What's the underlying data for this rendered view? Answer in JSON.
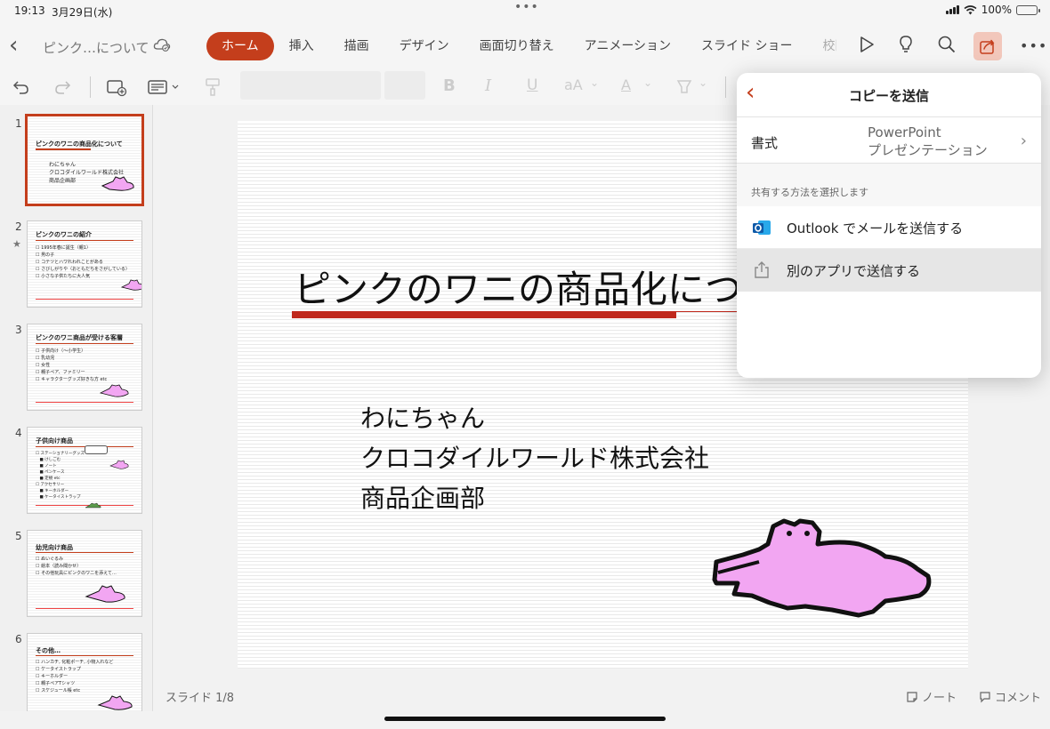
{
  "status_bar": {
    "time": "19:13",
    "date": "3月29日(水)",
    "battery": "100%"
  },
  "document": {
    "title": "ピンク…について"
  },
  "ribbon": {
    "tabs": [
      {
        "label": "ホーム",
        "active": true
      },
      {
        "label": "挿入"
      },
      {
        "label": "描画"
      },
      {
        "label": "デザイン"
      },
      {
        "label": "画面切り替え"
      },
      {
        "label": "アニメーション"
      },
      {
        "label": "スライド ショー"
      },
      {
        "label": "校閲"
      }
    ]
  },
  "icons": {
    "back": "chevron-left-icon",
    "cloud": "cloud-sync-icon",
    "play": "play-icon",
    "ideas": "lightbulb-icon",
    "search": "search-icon",
    "share": "share-icon",
    "more": "more-icon",
    "undo": "undo-icon",
    "redo": "redo-icon",
    "new_slide": "new-slide-icon",
    "layout": "layout-icon",
    "format_painter": "format-painter-icon",
    "bold": "bold-icon",
    "italic": "italic-icon",
    "underline": "underline-icon",
    "font_size": "font-size-icon",
    "font_color": "font-color-icon",
    "highlight": "highlight-icon"
  },
  "toolbar": {
    "bold": "B",
    "italic": "I",
    "underline": "U",
    "font_size": "aA",
    "font_color": "A"
  },
  "accent_color": "#c43e1c",
  "thumbnails": [
    {
      "num": "1",
      "title": "ピンクのワニの商品化について",
      "body": [
        "わにちゃん",
        "クロコダイルワールド株式会社",
        "商品企画部"
      ]
    },
    {
      "num": "2",
      "star": "★",
      "title": "ピンクのワニの紹介",
      "body": [
        "☐ 1995年春に誕生（親1）",
        "☐ 男の子",
        "☐ コテツとハワれわれことがある",
        "☐ さびしがりや（おともだちをさがしている）",
        "☐ 小さな子供たちに大人気"
      ]
    },
    {
      "num": "3",
      "title": "ピンクのワニ商品が受ける客層",
      "body": [
        "☐ 子供向け（〜小学生）",
        "☐ 乳幼児",
        "☐ 女性",
        "☐ 親子ペア、ファミリー",
        "☐ キャラクターグッズ好きな方 etc"
      ]
    },
    {
      "num": "4",
      "title": "子供向け商品",
      "body": [
        "☐ ステーショナリーグッズ",
        "　■ けしごむ",
        "　■ ノート",
        "　■ ペンケース",
        "　■ 定規 etc",
        "☐ アクセサリー",
        "　■ キーホルダー",
        "　■ ケータイストラップ"
      ]
    },
    {
      "num": "5",
      "title": "幼児向け商品",
      "body": [
        "☐ ぬいぐるみ",
        "☐ 絵本（読み聞かせ）",
        "☐ その他玩具にピンクのワニを添えて…"
      ]
    },
    {
      "num": "6",
      "title": "その他…",
      "body": [
        "☐ ハンカチ, 化粧ポーチ, 小物入れなど",
        "☐ ケータイストラップ",
        "☐ キーホルダー",
        "☐ 親子ペアTシャツ",
        "☐ スケジュール帳 etc"
      ]
    }
  ],
  "slide": {
    "title": "ピンクのワニの商品化について",
    "body": [
      "わにちゃん",
      "クロコダイルワールド株式会社",
      "商品企画部"
    ]
  },
  "footer": {
    "slide_count": "スライド 1/8",
    "notes": "ノート",
    "comments": "コメント"
  },
  "share_panel": {
    "title": "コピーを送信",
    "format_label": "書式",
    "format_value_line1": "PowerPoint",
    "format_value_line2": "プレゼンテーション",
    "section_label": "共有する方法を選択します",
    "options": [
      {
        "label": "Outlook でメールを送信する",
        "icon": "outlook-icon"
      },
      {
        "label": "別のアプリで送信する",
        "icon": "share-sheet-icon",
        "highlighted": true
      }
    ]
  }
}
